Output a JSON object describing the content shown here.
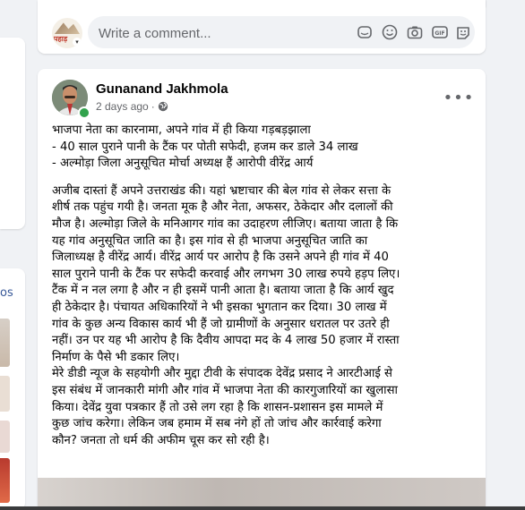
{
  "left_sidebar": {
    "partial_link": "os"
  },
  "composer": {
    "avatar_text": "पहाड़",
    "placeholder": "Write a comment...",
    "icons": [
      "sticker-icon",
      "emoji-icon",
      "camera-icon",
      "gif-icon",
      "avatar-sticker-icon"
    ]
  },
  "post": {
    "author": "Gunanand Jakhmola",
    "time": "2 days ago",
    "dot": "·",
    "audience_icon": "globe-icon",
    "more_icon": "more-options-icon",
    "headline": [
      "भाजपा नेता का कारनामा, अपने गांव में ही किया गड़बड़झाला",
      "- 40 साल पुराने पानी के टैंक पर पोती सफेदी, हजम कर डाले 34 लाख",
      "- अल्मोड़ा जिला अनुसूचित मोर्चा अध्यक्ष हैं आरोपी वीरेंद्र आर्य"
    ],
    "body": [
      "अजीब दास्तां हैं अपने उत्तराखंड की। यहां भ्रष्टाचार की बेल गांव से लेकर सत्ता के",
      "शीर्ष तक पहुंच गयी है। जनता मूक है और नेता, अफसर, ठेकेदार और दलालों की",
      "मौज है। अल्मोड़ा जिले के मनिआगर गांव का उदाहरण लीजिए। बताया जाता है कि",
      "यह गांव अनुसूचित जाति का है। इस गांव से ही भाजपा अनुसूचित जाति का",
      "जिलाध्यक्ष है वीरेंद्र आर्य। वीरेंद्र आर्य पर आरोप है कि उसने अपने ही गांव में 40",
      "साल पुराने पानी के टैंक पर सफेदी करवाई और लगभग 30 लाख रुपये हड़प लिए।",
      "टैंक में न नल लगा है और न ही इसमें पानी आता है। बताया जाता है कि आर्य खुद",
      "ही ठेकेदार है। पंचायत अधिकारियों ने भी इसका भुगतान कर दिया। 30 लाख में",
      "गांव के कुछ अन्य विकास कार्य भी हैं जो ग्रामीणों के अनुसार धरातल पर उतरे ही",
      "नहीं। उन पर यह भी आरोप है कि दैवीय आपदा मद के 4 लाख 50 हजार में रास्ता",
      "निर्माण के पैसे भी डकार लिए।",
      "मेरे डीडी न्यूज के सहयोगी और मुद्दा टीवी के संपादक देवेंद्र प्रसाद ने आरटीआई से",
      "इस संबंध में जानकारी मांगी और गांव में भाजपा नेता की कारगुजारियों का खुलासा",
      "किया। देवेंद्र युवा पत्रकार हैं तो उसे लग रहा है कि शासन-प्रशासन इस मामले में",
      "कुछ जांच करेगा। लेकिन जब हमाम में सब नंगे हों तो जांच और कार्रवाई करेगा",
      "कौन? जनता तो धर्म की अफीम चूस कर सो रही है।"
    ]
  }
}
